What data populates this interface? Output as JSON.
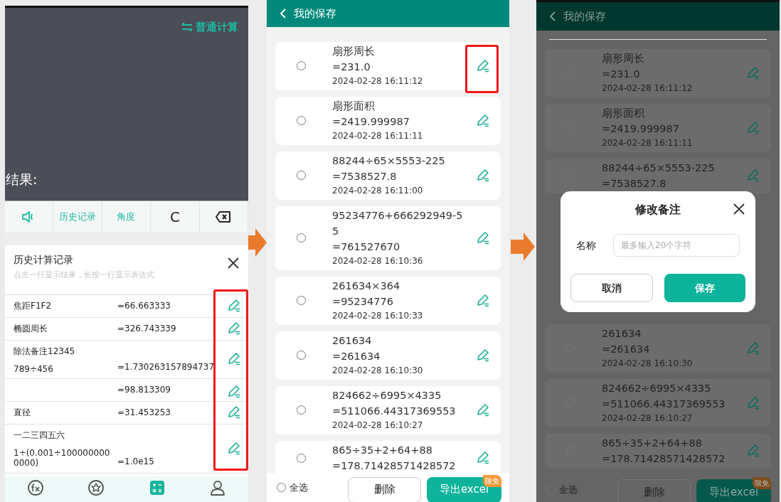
{
  "calculator": {
    "mode_toggle": "普通计算",
    "result_label": "结果:",
    "keys": [
      {
        "kind": "sound"
      },
      {
        "kind": "text",
        "label": "历史记录",
        "accent": true
      },
      {
        "kind": "text",
        "label": "角度",
        "accent": true
      },
      {
        "kind": "text",
        "label": "C",
        "accent": false
      },
      {
        "kind": "backspace"
      }
    ],
    "history": {
      "title": "历史计算记录",
      "hint": "点击一行显示结果，长按一行显示表达式",
      "highlighted": true,
      "rows": [
        {
          "note": "焦距F1F2",
          "result": "=66.663333"
        },
        {
          "note": "椭圆周长",
          "result": "=326.743339"
        },
        {
          "note": "除法备注12345",
          "expression": "789÷456",
          "result": "=1.730263157894737"
        },
        {
          "result": "=98.813309"
        },
        {
          "note": "直径",
          "result": "=31.453253"
        },
        {
          "note": "一二三四五六",
          "expression": "1÷(0.001÷1000000000000)",
          "result": "=1.0e15"
        }
      ]
    },
    "bottom_nav": [
      {
        "kind": "fx",
        "selected": false
      },
      {
        "kind": "star",
        "selected": false
      },
      {
        "kind": "calculator",
        "selected": true
      },
      {
        "kind": "person",
        "selected": false
      }
    ]
  },
  "saved_list": {
    "title": "我的保存",
    "items": [
      {
        "expression": "扇形周长",
        "result": "=231.0",
        "time": "2024-02-28 16:11:12",
        "checked": false,
        "highlighted": true
      },
      {
        "expression": "扇形面积",
        "result": "=2419.999987",
        "time": "2024-02-28 16:11:11",
        "checked": false,
        "highlighted": false
      },
      {
        "expression": "88244÷65×5553-225",
        "result": "=7538527.8",
        "time": "2024-02-28 16:11:00",
        "checked": false,
        "highlighted": false
      },
      {
        "expression": "95234776+666292949-55",
        "result": "=761527670",
        "time": "2024-02-28 16:10:36",
        "checked": false,
        "highlighted": false
      },
      {
        "expression": "261634×364",
        "result": "=95234776",
        "time": "2024-02-28 16:10:33",
        "checked": false,
        "highlighted": false
      },
      {
        "expression": "261634",
        "result": "=261634",
        "time": "2024-02-28 16:10:30",
        "checked": false,
        "highlighted": false
      },
      {
        "expression": "824662÷6995×4335",
        "result": "=511066.44317369553",
        "time": "2024-02-28 16:10:27",
        "checked": false,
        "highlighted": false
      },
      {
        "expression": "865÷35+2+64+88",
        "result": "=178.71428571428572",
        "checked": false,
        "highlighted": false
      }
    ],
    "select_all": {
      "label": "全选",
      "checked": false
    },
    "delete_button": "删除",
    "export_button": "导出excel",
    "export_badge": "限免"
  },
  "edit_dialog_screen": {
    "title": "我的保存",
    "items_above": [
      {
        "expression": "扇形周长",
        "result": "=231.0",
        "time": "2024-02-28 16:11:12",
        "checked": false
      },
      {
        "expression": "扇形面积",
        "result": "=2419.999987",
        "time": "2024-02-28 16:11:11",
        "checked": false
      },
      {
        "expression": "88244÷65×5553-225",
        "result": "=7538527.8",
        "checked": false
      }
    ],
    "dialog": {
      "title": "修改备注",
      "field_label": "名称",
      "placeholder": "最多输入20个字符",
      "cancel_button": "取消",
      "save_button": "保存"
    },
    "items_below": [
      {
        "expression": "261634",
        "result": "=261634",
        "time": "2024-02-28 16:10:30",
        "checked": false
      },
      {
        "expression": "824662÷6995×4335",
        "result": "=511066.44317369553",
        "time": "2024-02-28 16:10:27",
        "checked": false
      },
      {
        "expression": "865÷35+2+64+88",
        "result": "=178.71428571428572",
        "checked": false
      }
    ],
    "select_all": {
      "label": "全选",
      "checked": false
    },
    "delete_button": "删除",
    "export_button": "导出excel",
    "export_badge": "限免"
  }
}
